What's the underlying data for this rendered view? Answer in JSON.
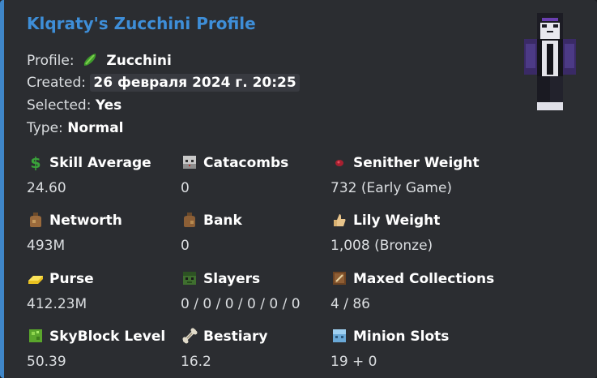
{
  "title": "Klqraty's Zucchini Profile",
  "info": {
    "profile_label": "Profile:",
    "profile_icon": "cucumber-icon",
    "profile_value": "Zucchini",
    "created_label": "Created:",
    "created_value": "26 февраля 2024 г. 20:25",
    "selected_label": "Selected:",
    "selected_value": "Yes",
    "type_label": "Type:",
    "type_value": "Normal"
  },
  "stats": [
    {
      "icon": "dollar-icon",
      "label": "Skill Average",
      "value": "24.60"
    },
    {
      "icon": "skull-icon",
      "label": "Catacombs",
      "value": "0"
    },
    {
      "icon": "spider-eye-icon",
      "label": "Senither Weight",
      "value": "732 (Early Game)"
    },
    {
      "icon": "money-bag-icon",
      "label": "Networth",
      "value": "493M"
    },
    {
      "icon": "coin-bag-icon",
      "label": "Bank",
      "value": "0"
    },
    {
      "icon": "thumbs-up-icon",
      "label": "Lily Weight",
      "value": "1,008 (Bronze)"
    },
    {
      "icon": "gold-ingot-icon",
      "label": "Purse",
      "value": "412.23M"
    },
    {
      "icon": "zombie-head-icon",
      "label": "Slayers",
      "value": "0 / 0 / 0 / 0 / 0 / 0"
    },
    {
      "icon": "book-icon",
      "label": "Maxed Collections",
      "value": "4 / 86"
    },
    {
      "icon": "experience-bottle-icon",
      "label": "SkyBlock Level",
      "value": "50.39"
    },
    {
      "icon": "bone-icon",
      "label": "Bestiary",
      "value": "16.2"
    },
    {
      "icon": "minion-icon",
      "label": "Minion Slots",
      "value": "19 + 0"
    }
  ],
  "colors": {
    "accent": "#3f86c8",
    "title": "#3e8ed8",
    "background": "#2b2d31"
  }
}
